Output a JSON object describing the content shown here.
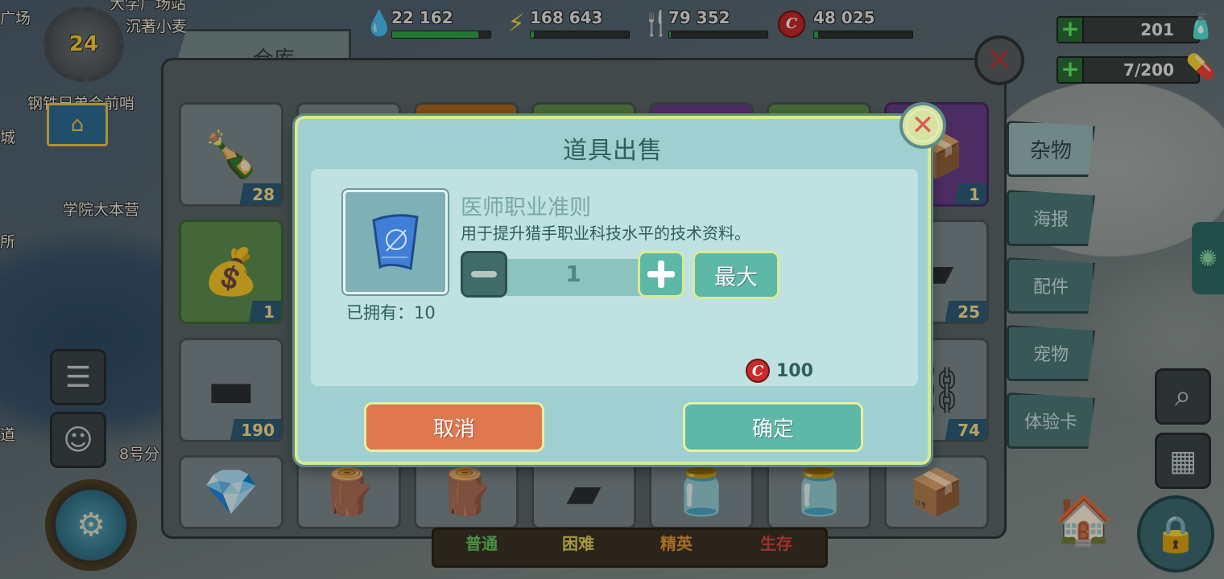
{
  "map": {
    "labels": [
      "沉著小麦",
      "广场",
      "钢铁兄弟会前哨",
      "学院大本营",
      "8号分",
      "道",
      "所",
      "城",
      "大学广场站"
    ]
  },
  "hud": {
    "level": "24",
    "resources": [
      {
        "icon": "water-drop-icon",
        "glyph": "💧",
        "value": "22 162",
        "fill": 0.88
      },
      {
        "icon": "lightning-icon",
        "glyph": "⚡",
        "value": "168 643",
        "fill": 0.03
      },
      {
        "icon": "fork-knife-icon",
        "glyph": "🍴",
        "value": "79 352",
        "fill": 0.02
      },
      {
        "icon": "bottle-cap-icon",
        "glyph": "C",
        "value": "48 025",
        "fill": 0.04
      }
    ],
    "right": [
      {
        "value": "201",
        "icon": "nuka-cola-icon",
        "glyph": "🧴"
      },
      {
        "value": "7/200",
        "icon": "stimpak-pill-icon",
        "glyph": "💊"
      }
    ]
  },
  "warehouse": {
    "title": "仓库",
    "side_tabs": [
      "杂物",
      "海报",
      "配件",
      "宠物",
      "体验卡"
    ],
    "active_side_tab": "杂物",
    "bottom_tabs": [
      "普通",
      "困难",
      "精英",
      "生存"
    ],
    "items": [
      {
        "icon": "nuka-cola-bottle-icon",
        "glyph": "🍾",
        "count": "28"
      },
      {
        "icon": "bottle-caps-stack-icon",
        "glyph": "💰",
        "count": "1"
      },
      {
        "icon": "metal-bar-icon",
        "glyph": "▬",
        "count": "190"
      },
      {
        "icon": "crystal-icon",
        "glyph": "💎",
        "count": ""
      },
      {
        "icon": "gold-bars-icon",
        "glyph": "🪵",
        "count": ""
      },
      {
        "icon": "wood-plank-icon",
        "glyph": "🪵",
        "count": ""
      },
      {
        "icon": "steel-ingot-icon",
        "glyph": "▰",
        "count": ""
      },
      {
        "icon": "adhesive-jar-icon",
        "glyph": "🫙",
        "count": ""
      },
      {
        "icon": "fertilizer-jar-icon",
        "glyph": "🫙",
        "count": ""
      },
      {
        "icon": "gears-box-icon",
        "glyph": "📦",
        "count": ""
      },
      {
        "icon": "cardboard-box-icon",
        "glyph": "📦",
        "count": "1"
      },
      {
        "icon": "dark-ingot-icon",
        "glyph": "▰",
        "count": "25"
      },
      {
        "icon": "tire-chain-icon",
        "glyph": "⛓",
        "count": "74"
      }
    ]
  },
  "dialog": {
    "title": "道具出售",
    "item_name": "医师职业准则",
    "item_desc": "用于提升猎手职业科技水平的技术资料。",
    "owned_label": "已拥有：10",
    "quantity": "1",
    "max_label": "最大",
    "price": "100",
    "cancel_label": "取消",
    "confirm_label": "确定"
  }
}
